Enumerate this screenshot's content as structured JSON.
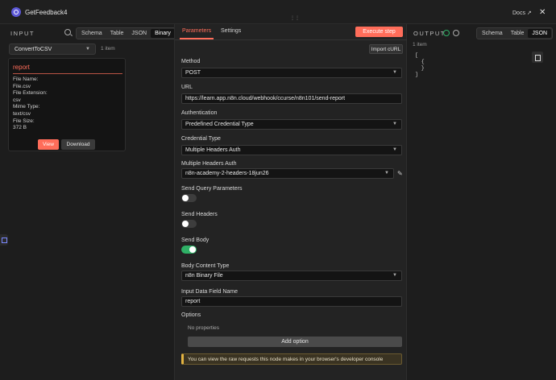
{
  "header": {
    "title": "GetFeedback4",
    "docs_label": "Docs ↗",
    "close_glyph": "✕"
  },
  "input": {
    "heading": "INPUT",
    "tabs": [
      "Schema",
      "Table",
      "JSON",
      "Binary"
    ],
    "active_tab": "Binary",
    "node_select": "ConvertToCSV",
    "items_count": "1 item",
    "binary_card": {
      "title": "report",
      "lines": [
        "File Name:",
        "File.csv",
        "File Extension:",
        "csv",
        "Mime Type:",
        "text/csv",
        "File Size:",
        "372 B"
      ],
      "view_label": "View",
      "download_label": "Download"
    }
  },
  "params": {
    "tab_parameters": "Parameters",
    "tab_settings": "Settings",
    "execute_label": "Execute step",
    "import_label": "Import cURL",
    "method_label": "Method",
    "method_value": "POST",
    "url_label": "URL",
    "url_value": "https://learn.app.n8n.cloud/webhook/ccurse/n8n101/send-report",
    "auth_label": "Authentication",
    "auth_value": "Predefined Credential Type",
    "cred_type_label": "Credential Type",
    "cred_type_value": "Multiple Headers Auth",
    "mha_label": "Multiple Headers Auth",
    "mha_value": "n8n-academy-2-headers-18jun26",
    "send_query_label": "Send Query Parameters",
    "send_query_on": false,
    "send_headers_label": "Send Headers",
    "send_headers_on": false,
    "send_body_label": "Send Body",
    "send_body_on": true,
    "body_ct_label": "Body Content Type",
    "body_ct_value": "n8n Binary File",
    "input_field_label": "Input Data Field Name",
    "input_field_value": "report",
    "options_label": "Options",
    "no_properties": "No properties",
    "add_option_label": "Add option",
    "notice": "You can view the raw requests this node makes in your browser's developer console"
  },
  "output": {
    "heading": "OUTPUT",
    "tabs": [
      "Schema",
      "Table",
      "JSON"
    ],
    "active_tab": "JSON",
    "items_count": "1 item",
    "json_text": "[\n  {\n  }\n]"
  },
  "colors": {
    "accent": "#ff6d5a",
    "success": "#2fb066",
    "node_icon": "#5b57d6"
  }
}
